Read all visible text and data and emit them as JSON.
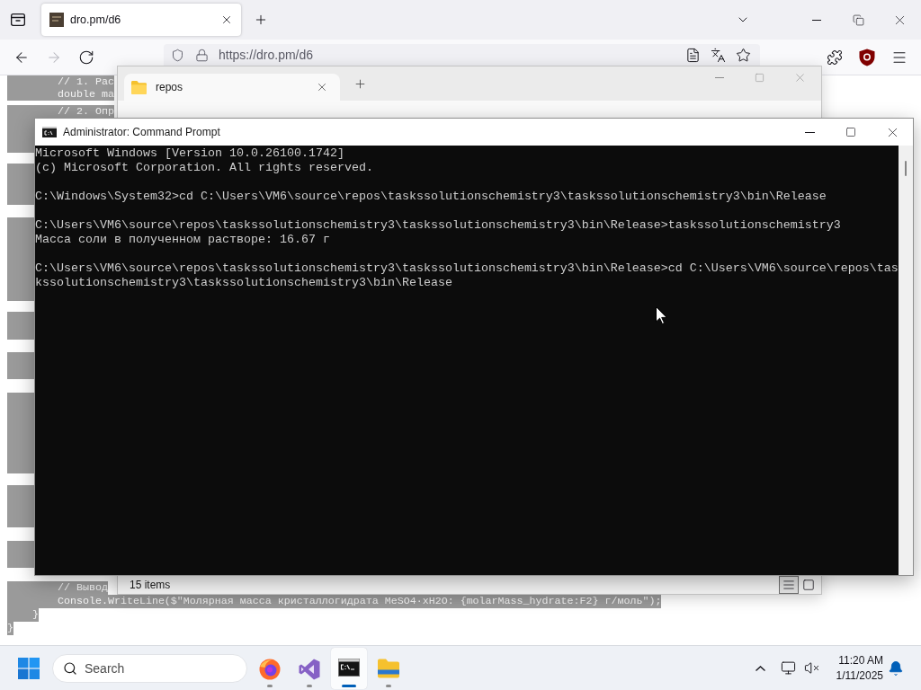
{
  "browser": {
    "tabs": [
      {
        "title": "dro.pm/d6",
        "selected": true
      }
    ],
    "nav_buttons": [
      {
        "kind": "back",
        "disabled": false
      },
      {
        "kind": "forward",
        "disabled": true
      },
      {
        "kind": "reload",
        "disabled": false
      }
    ],
    "address": "https://dro.pm/d6"
  },
  "page": {
    "top_lines": [
      {
        "text": "        // 1. Рас",
        "selected": true
      },
      {
        "text": "        double ma",
        "selected": true
      },
      {
        "text": "        // 2. Опр",
        "selected": true
      }
    ],
    "bottom_lines": [
      {
        "text": "        // Вывод",
        "selected": true
      },
      {
        "text": "        Console.WriteLine($\"Молярная масса кристаллогидрата MeSO4·xH2O: {molarMass_hydrate:F2} г/моль\");",
        "selected": true
      },
      {
        "text": "    }",
        "selected": true
      },
      {
        "text": "}",
        "selected": true
      }
    ]
  },
  "explorer": {
    "tabs": [
      {
        "title": "repos",
        "selected": true
      }
    ],
    "status": "15 items",
    "views": [
      {
        "kind": "details",
        "selected": true
      },
      {
        "kind": "tiles",
        "selected": false
      }
    ]
  },
  "terminal": {
    "title": "Administrator: Command Prompt",
    "blocks": [
      [
        "Microsoft Windows [Version 10.0.26100.1742]",
        "(c) Microsoft Corporation. All rights reserved."
      ],
      [
        "C:\\Windows\\System32>cd C:\\Users\\VM6\\source\\repos\\taskssolutionschemistry3\\taskssolutionschemistry3\\bin\\Release"
      ],
      [
        "C:\\Users\\VM6\\source\\repos\\taskssolutionschemistry3\\taskssolutionschemistry3\\bin\\Release>taskssolutionschemistry3",
        "Масса соли в полученном растворе: 16.67 г"
      ],
      [
        "C:\\Users\\VM6\\source\\repos\\taskssolutionschemistry3\\taskssolutionschemistry3\\bin\\Release>cd C:\\Users\\VM6\\source\\repos\\taskssolutionschemistry3\\taskssolutionschemistry3\\bin\\Release"
      ]
    ]
  },
  "taskbar": {
    "search": {
      "placeholder": "Search"
    },
    "apps": [
      {
        "kind": "browser",
        "selected": false
      },
      {
        "kind": "ide",
        "selected": false
      },
      {
        "kind": "terminal",
        "selected": true
      },
      {
        "kind": "files",
        "selected": false
      }
    ],
    "clock": {
      "time": "11:20 AM",
      "date": "1/11/2025"
    }
  }
}
